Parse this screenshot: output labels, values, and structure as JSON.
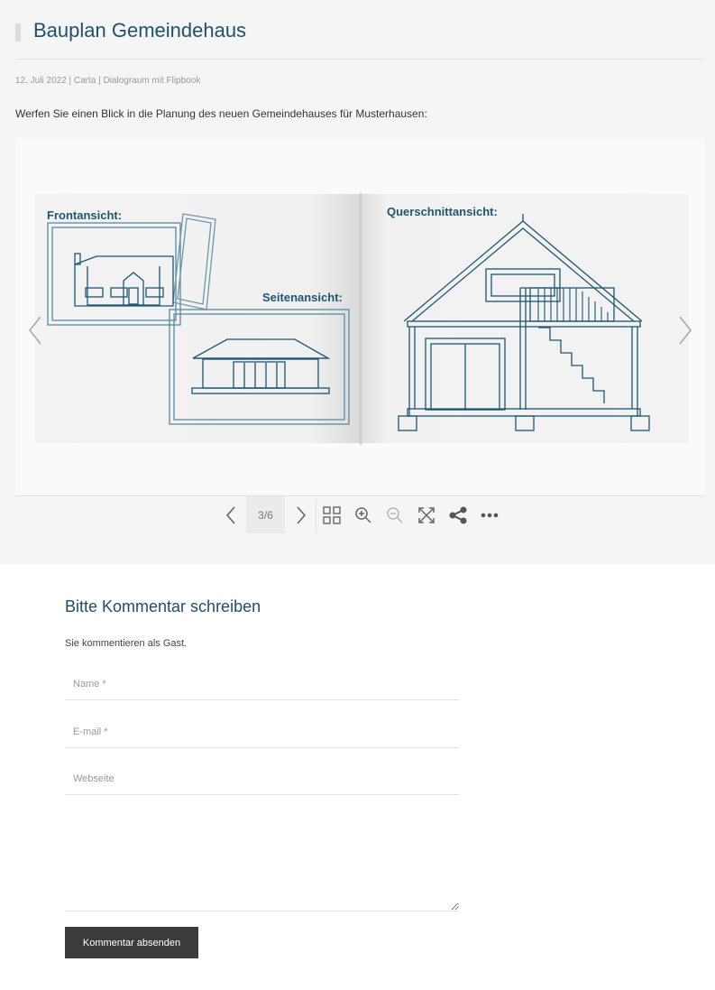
{
  "post": {
    "title": "Bauplan Gemeindehaus",
    "meta": "12. Juli 2022 | Carta | Dialograum mit Flipbook",
    "intro": "Werfen Sie einen Blick in die Planung des neuen Gemeindehauses für Musterhausen:"
  },
  "flipbook": {
    "labels": {
      "front": "Frontansicht:",
      "side": "Seitenansicht:",
      "section": "Querschnittansicht:"
    },
    "page_counter": "3/6",
    "page_current": 3,
    "page_total": 6,
    "toolbar": [
      "prev-page",
      "page-counter",
      "next-page",
      "thumbnails",
      "zoom-in",
      "zoom-out",
      "fullscreen",
      "share",
      "more"
    ],
    "colors": {
      "blueprint": "#1d5671",
      "accent": "#1f5169"
    }
  },
  "comments": {
    "heading": "Bitte Kommentar schreiben",
    "guest_note": "Sie kommentieren als Gast.",
    "name_placeholder": "Name *",
    "email_placeholder": "E-mail *",
    "website_placeholder": "Webseite",
    "submit_label": "Kommentar absenden"
  }
}
